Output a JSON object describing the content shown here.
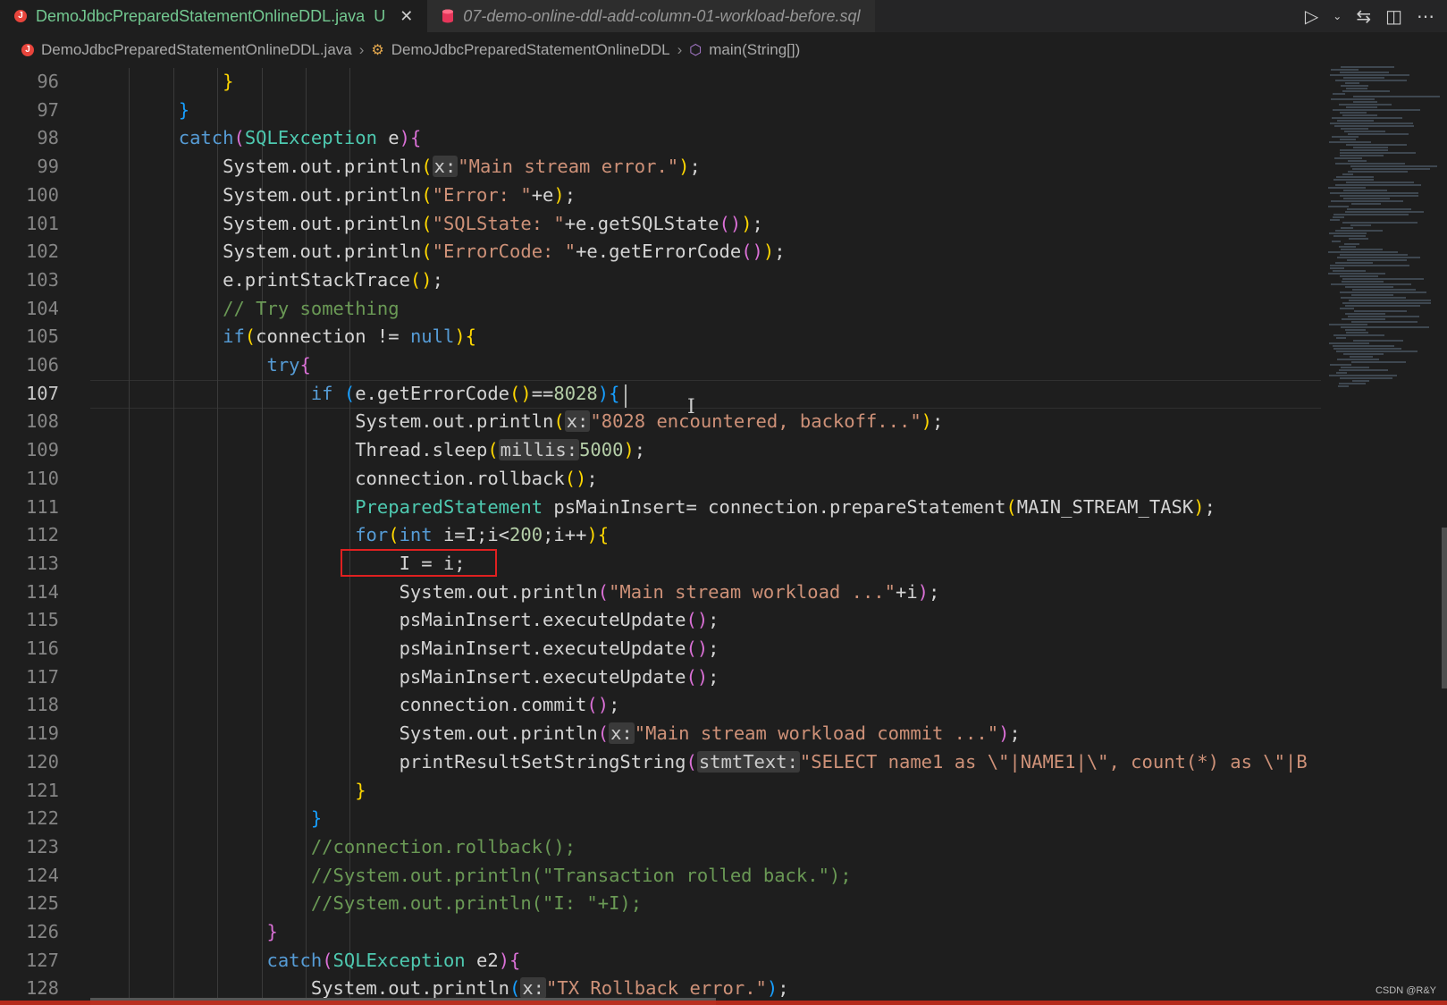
{
  "tabs": [
    {
      "label": "DemoJdbcPreparedStatementOnlineDDL.java",
      "status": "U",
      "active": true
    },
    {
      "label": "07-demo-online-ddl-add-column-01-workload-before.sql",
      "active": false
    }
  ],
  "tab_actions": [
    "run-icon",
    "run-dropdown-icon",
    "source-control-icon",
    "split-editor-icon",
    "more-actions-icon"
  ],
  "breadcrumb": {
    "file": "DemoJdbcPreparedStatementOnlineDDL.java",
    "class": "DemoJdbcPreparedStatementOnlineDDL",
    "method": "main(String[])"
  },
  "editor": {
    "current_line": 107,
    "highlighted_line": 113,
    "lines": [
      {
        "n": 96,
        "tokens": [
          [
            "            ",
            "p"
          ],
          [
            "}",
            "b1"
          ]
        ]
      },
      {
        "n": 97,
        "tokens": [
          [
            "        ",
            "p"
          ],
          [
            "}",
            "b3"
          ]
        ]
      },
      {
        "n": 98,
        "tokens": [
          [
            "        ",
            "p"
          ],
          [
            "catch",
            "kw"
          ],
          [
            "(",
            "b2"
          ],
          [
            "SQLException",
            "type"
          ],
          [
            " e",
            "p"
          ],
          [
            ")",
            "b2"
          ],
          [
            "{",
            "b2"
          ]
        ]
      },
      {
        "n": 99,
        "tokens": [
          [
            "            System.out.println",
            "p"
          ],
          [
            "(",
            "b1"
          ],
          [
            "x:",
            "hint"
          ],
          [
            "\"Main stream error.\"",
            "str"
          ],
          [
            ")",
            "b1"
          ],
          [
            ";",
            "p"
          ]
        ]
      },
      {
        "n": 100,
        "tokens": [
          [
            "            System.out.println",
            "p"
          ],
          [
            "(",
            "b1"
          ],
          [
            "\"Error: \"",
            "str"
          ],
          [
            "+e",
            "p"
          ],
          [
            ")",
            "b1"
          ],
          [
            ";",
            "p"
          ]
        ]
      },
      {
        "n": 101,
        "tokens": [
          [
            "            System.out.println",
            "p"
          ],
          [
            "(",
            "b1"
          ],
          [
            "\"SQLState: \"",
            "str"
          ],
          [
            "+e.getSQLState",
            "p"
          ],
          [
            "()",
            "b2"
          ],
          [
            ")",
            "b1"
          ],
          [
            ";",
            "p"
          ]
        ]
      },
      {
        "n": 102,
        "tokens": [
          [
            "            System.out.println",
            "p"
          ],
          [
            "(",
            "b1"
          ],
          [
            "\"ErrorCode: \"",
            "str"
          ],
          [
            "+e.getErrorCode",
            "p"
          ],
          [
            "()",
            "b2"
          ],
          [
            ")",
            "b1"
          ],
          [
            ";",
            "p"
          ]
        ]
      },
      {
        "n": 103,
        "tokens": [
          [
            "            e.printStackTrace",
            "p"
          ],
          [
            "()",
            "b1"
          ],
          [
            ";",
            "p"
          ]
        ]
      },
      {
        "n": 104,
        "tokens": [
          [
            "            ",
            "p"
          ],
          [
            "// Try something",
            "cmt"
          ]
        ]
      },
      {
        "n": 105,
        "tokens": [
          [
            "            ",
            "p"
          ],
          [
            "if",
            "kw"
          ],
          [
            "(",
            "b1"
          ],
          [
            "connection != ",
            "p"
          ],
          [
            "null",
            "kw"
          ],
          [
            ")",
            "b1"
          ],
          [
            "{",
            "b1"
          ]
        ]
      },
      {
        "n": 106,
        "tokens": [
          [
            "                ",
            "p"
          ],
          [
            "try",
            "kw"
          ],
          [
            "{",
            "b2"
          ]
        ]
      },
      {
        "n": 107,
        "tokens": [
          [
            "                    ",
            "p"
          ],
          [
            "if",
            "kw"
          ],
          [
            " ",
            "p"
          ],
          [
            "(",
            "b3"
          ],
          [
            "e.getErrorCode",
            "p"
          ],
          [
            "()",
            "b1"
          ],
          [
            "==",
            "p"
          ],
          [
            "8028",
            "num"
          ],
          [
            ")",
            "b3"
          ],
          [
            "{",
            "b3"
          ]
        ]
      },
      {
        "n": 108,
        "tokens": [
          [
            "                        System.out.println",
            "p"
          ],
          [
            "(",
            "b1"
          ],
          [
            "x:",
            "hint"
          ],
          [
            "\"8028 encountered, backoff...\"",
            "str"
          ],
          [
            ")",
            "b1"
          ],
          [
            ";",
            "p"
          ]
        ]
      },
      {
        "n": 109,
        "tokens": [
          [
            "                        Thread.sleep",
            "p"
          ],
          [
            "(",
            "b1"
          ],
          [
            "millis:",
            "hint"
          ],
          [
            "5000",
            "num"
          ],
          [
            ")",
            "b1"
          ],
          [
            ";",
            "p"
          ]
        ]
      },
      {
        "n": 110,
        "tokens": [
          [
            "                        connection.rollback",
            "p"
          ],
          [
            "()",
            "b1"
          ],
          [
            ";",
            "p"
          ]
        ]
      },
      {
        "n": 111,
        "tokens": [
          [
            "                        ",
            "p"
          ],
          [
            "PreparedStatement",
            "type"
          ],
          [
            " psMainInsert= connection.prepareStatement",
            "p"
          ],
          [
            "(",
            "b1"
          ],
          [
            "MAIN_STREAM_TASK",
            "p"
          ],
          [
            ")",
            "b1"
          ],
          [
            ";",
            "p"
          ]
        ]
      },
      {
        "n": 112,
        "tokens": [
          [
            "                        ",
            "p"
          ],
          [
            "for",
            "kw"
          ],
          [
            "(",
            "b1"
          ],
          [
            "int",
            "kw"
          ],
          [
            " i=I;i<",
            "p"
          ],
          [
            "200",
            "num"
          ],
          [
            ";i++",
            "p"
          ],
          [
            ")",
            "b1"
          ],
          [
            "{",
            "b1"
          ]
        ]
      },
      {
        "n": 113,
        "tokens": [
          [
            "                            I = i;",
            "p"
          ]
        ]
      },
      {
        "n": 114,
        "tokens": [
          [
            "                            System.out.println",
            "p"
          ],
          [
            "(",
            "b2"
          ],
          [
            "\"Main stream workload ...\"",
            "str"
          ],
          [
            "+i",
            "p"
          ],
          [
            ")",
            "b2"
          ],
          [
            ";",
            "p"
          ]
        ]
      },
      {
        "n": 115,
        "tokens": [
          [
            "                            psMainInsert.executeUpdate",
            "p"
          ],
          [
            "()",
            "b2"
          ],
          [
            ";",
            "p"
          ]
        ]
      },
      {
        "n": 116,
        "tokens": [
          [
            "                            psMainInsert.executeUpdate",
            "p"
          ],
          [
            "()",
            "b2"
          ],
          [
            ";",
            "p"
          ]
        ]
      },
      {
        "n": 117,
        "tokens": [
          [
            "                            psMainInsert.executeUpdate",
            "p"
          ],
          [
            "()",
            "b2"
          ],
          [
            ";",
            "p"
          ]
        ]
      },
      {
        "n": 118,
        "tokens": [
          [
            "                            connection.commit",
            "p"
          ],
          [
            "()",
            "b2"
          ],
          [
            ";",
            "p"
          ]
        ]
      },
      {
        "n": 119,
        "tokens": [
          [
            "                            System.out.println",
            "p"
          ],
          [
            "(",
            "b2"
          ],
          [
            "x:",
            "hint"
          ],
          [
            "\"Main stream workload commit ...\"",
            "str"
          ],
          [
            ")",
            "b2"
          ],
          [
            ";",
            "p"
          ]
        ]
      },
      {
        "n": 120,
        "tokens": [
          [
            "                            printResultSetStringString",
            "p"
          ],
          [
            "(",
            "b2"
          ],
          [
            "stmtText:",
            "hint"
          ],
          [
            "\"SELECT name1 as \\\"|NAME1|\\\", count(*) as \\\"|B",
            "str"
          ]
        ]
      },
      {
        "n": 121,
        "tokens": [
          [
            "                        ",
            "p"
          ],
          [
            "}",
            "b1"
          ]
        ]
      },
      {
        "n": 122,
        "tokens": [
          [
            "                    ",
            "p"
          ],
          [
            "}",
            "b3"
          ]
        ]
      },
      {
        "n": 123,
        "tokens": [
          [
            "                    ",
            "p"
          ],
          [
            "//connection.rollback();",
            "cmt"
          ]
        ]
      },
      {
        "n": 124,
        "tokens": [
          [
            "                    ",
            "p"
          ],
          [
            "//System.out.println(\"Transaction rolled back.\");",
            "cmt"
          ]
        ]
      },
      {
        "n": 125,
        "tokens": [
          [
            "                    ",
            "p"
          ],
          [
            "//System.out.println(\"I: \"+I);",
            "cmt"
          ]
        ]
      },
      {
        "n": 126,
        "tokens": [
          [
            "                ",
            "p"
          ],
          [
            "}",
            "b2"
          ]
        ]
      },
      {
        "n": 127,
        "tokens": [
          [
            "                ",
            "p"
          ],
          [
            "catch",
            "kw"
          ],
          [
            "(",
            "b2"
          ],
          [
            "SQLException",
            "type"
          ],
          [
            " e2",
            "p"
          ],
          [
            ")",
            "b2"
          ],
          [
            "{",
            "b2"
          ]
        ]
      },
      {
        "n": 128,
        "tokens": [
          [
            "                    System.out.println",
            "p"
          ],
          [
            "(",
            "b3"
          ],
          [
            "x:",
            "hint"
          ],
          [
            "\"TX Rollback error.\"",
            "str"
          ],
          [
            ")",
            "b3"
          ],
          [
            ";",
            "p"
          ]
        ]
      }
    ]
  },
  "watermark": "CSDN @R&Y"
}
